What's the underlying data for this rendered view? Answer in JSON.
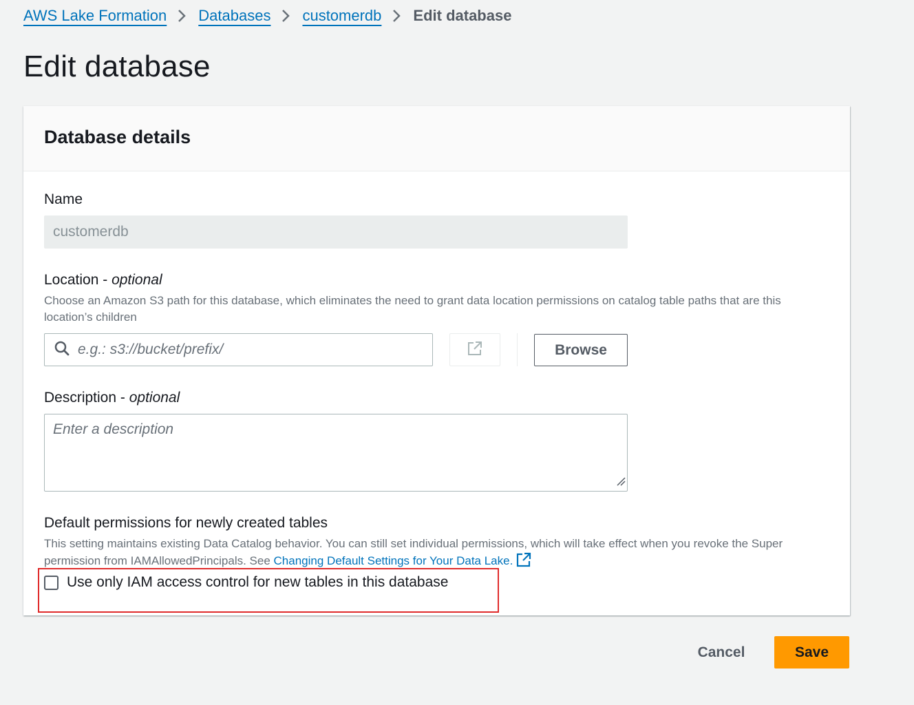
{
  "breadcrumb": {
    "items": [
      "AWS Lake Formation",
      "Databases",
      "customerdb"
    ],
    "current": "Edit database"
  },
  "page": {
    "title": "Edit database"
  },
  "panel": {
    "title": "Database details",
    "name": {
      "label": "Name",
      "value": "customerdb"
    },
    "location": {
      "label": "Location",
      "optional": "optional",
      "description": "Choose an Amazon S3 path for this database, which eliminates the need to grant data location permissions on catalog table paths that are this location’s children",
      "placeholder": "e.g.: s3://bucket/prefix/",
      "browse_label": "Browse"
    },
    "description": {
      "label": "Description",
      "optional": "optional",
      "placeholder": "Enter a description"
    },
    "default_permissions": {
      "label": "Default permissions for newly created tables",
      "description": "This setting maintains existing Data Catalog behavior. You can still set individual permissions, which will take effect when you revoke the Super permission from IAMAllowedPrincipals. See",
      "link_text": "Changing Default Settings for Your Data Lake.",
      "checkbox_label": "Use only IAM access control for new tables in this database",
      "checkbox_checked": false
    }
  },
  "footer": {
    "cancel_label": "Cancel",
    "save_label": "Save"
  },
  "icons": {
    "breadcrumb_separator": "chevron-right-icon",
    "search": "search-icon",
    "external_link": "external-link-icon",
    "resize": "resize-grip-icon"
  },
  "colors": {
    "link": "#0073bb",
    "primary_button": "#ff9900",
    "highlight": "#e02a2a",
    "background": "#f2f3f3"
  }
}
